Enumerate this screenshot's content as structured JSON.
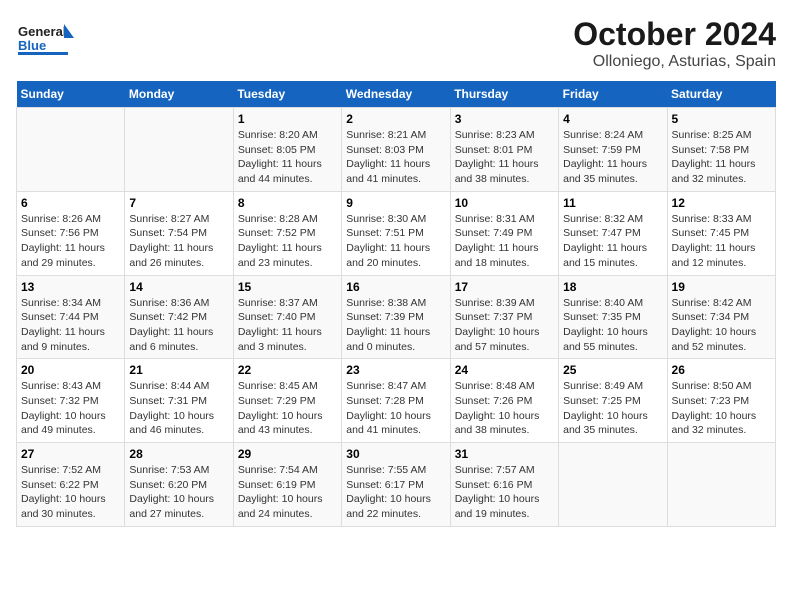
{
  "header": {
    "logo_line1": "General",
    "logo_line2": "Blue",
    "title": "October 2024",
    "subtitle": "Olloniego, Asturias, Spain"
  },
  "days_of_week": [
    "Sunday",
    "Monday",
    "Tuesday",
    "Wednesday",
    "Thursday",
    "Friday",
    "Saturday"
  ],
  "weeks": [
    [
      {
        "day": "",
        "info": ""
      },
      {
        "day": "",
        "info": ""
      },
      {
        "day": "1",
        "info": "Sunrise: 8:20 AM\nSunset: 8:05 PM\nDaylight: 11 hours and 44 minutes."
      },
      {
        "day": "2",
        "info": "Sunrise: 8:21 AM\nSunset: 8:03 PM\nDaylight: 11 hours and 41 minutes."
      },
      {
        "day": "3",
        "info": "Sunrise: 8:23 AM\nSunset: 8:01 PM\nDaylight: 11 hours and 38 minutes."
      },
      {
        "day": "4",
        "info": "Sunrise: 8:24 AM\nSunset: 7:59 PM\nDaylight: 11 hours and 35 minutes."
      },
      {
        "day": "5",
        "info": "Sunrise: 8:25 AM\nSunset: 7:58 PM\nDaylight: 11 hours and 32 minutes."
      }
    ],
    [
      {
        "day": "6",
        "info": "Sunrise: 8:26 AM\nSunset: 7:56 PM\nDaylight: 11 hours and 29 minutes."
      },
      {
        "day": "7",
        "info": "Sunrise: 8:27 AM\nSunset: 7:54 PM\nDaylight: 11 hours and 26 minutes."
      },
      {
        "day": "8",
        "info": "Sunrise: 8:28 AM\nSunset: 7:52 PM\nDaylight: 11 hours and 23 minutes."
      },
      {
        "day": "9",
        "info": "Sunrise: 8:30 AM\nSunset: 7:51 PM\nDaylight: 11 hours and 20 minutes."
      },
      {
        "day": "10",
        "info": "Sunrise: 8:31 AM\nSunset: 7:49 PM\nDaylight: 11 hours and 18 minutes."
      },
      {
        "day": "11",
        "info": "Sunrise: 8:32 AM\nSunset: 7:47 PM\nDaylight: 11 hours and 15 minutes."
      },
      {
        "day": "12",
        "info": "Sunrise: 8:33 AM\nSunset: 7:45 PM\nDaylight: 11 hours and 12 minutes."
      }
    ],
    [
      {
        "day": "13",
        "info": "Sunrise: 8:34 AM\nSunset: 7:44 PM\nDaylight: 11 hours and 9 minutes."
      },
      {
        "day": "14",
        "info": "Sunrise: 8:36 AM\nSunset: 7:42 PM\nDaylight: 11 hours and 6 minutes."
      },
      {
        "day": "15",
        "info": "Sunrise: 8:37 AM\nSunset: 7:40 PM\nDaylight: 11 hours and 3 minutes."
      },
      {
        "day": "16",
        "info": "Sunrise: 8:38 AM\nSunset: 7:39 PM\nDaylight: 11 hours and 0 minutes."
      },
      {
        "day": "17",
        "info": "Sunrise: 8:39 AM\nSunset: 7:37 PM\nDaylight: 10 hours and 57 minutes."
      },
      {
        "day": "18",
        "info": "Sunrise: 8:40 AM\nSunset: 7:35 PM\nDaylight: 10 hours and 55 minutes."
      },
      {
        "day": "19",
        "info": "Sunrise: 8:42 AM\nSunset: 7:34 PM\nDaylight: 10 hours and 52 minutes."
      }
    ],
    [
      {
        "day": "20",
        "info": "Sunrise: 8:43 AM\nSunset: 7:32 PM\nDaylight: 10 hours and 49 minutes."
      },
      {
        "day": "21",
        "info": "Sunrise: 8:44 AM\nSunset: 7:31 PM\nDaylight: 10 hours and 46 minutes."
      },
      {
        "day": "22",
        "info": "Sunrise: 8:45 AM\nSunset: 7:29 PM\nDaylight: 10 hours and 43 minutes."
      },
      {
        "day": "23",
        "info": "Sunrise: 8:47 AM\nSunset: 7:28 PM\nDaylight: 10 hours and 41 minutes."
      },
      {
        "day": "24",
        "info": "Sunrise: 8:48 AM\nSunset: 7:26 PM\nDaylight: 10 hours and 38 minutes."
      },
      {
        "day": "25",
        "info": "Sunrise: 8:49 AM\nSunset: 7:25 PM\nDaylight: 10 hours and 35 minutes."
      },
      {
        "day": "26",
        "info": "Sunrise: 8:50 AM\nSunset: 7:23 PM\nDaylight: 10 hours and 32 minutes."
      }
    ],
    [
      {
        "day": "27",
        "info": "Sunrise: 7:52 AM\nSunset: 6:22 PM\nDaylight: 10 hours and 30 minutes."
      },
      {
        "day": "28",
        "info": "Sunrise: 7:53 AM\nSunset: 6:20 PM\nDaylight: 10 hours and 27 minutes."
      },
      {
        "day": "29",
        "info": "Sunrise: 7:54 AM\nSunset: 6:19 PM\nDaylight: 10 hours and 24 minutes."
      },
      {
        "day": "30",
        "info": "Sunrise: 7:55 AM\nSunset: 6:17 PM\nDaylight: 10 hours and 22 minutes."
      },
      {
        "day": "31",
        "info": "Sunrise: 7:57 AM\nSunset: 6:16 PM\nDaylight: 10 hours and 19 minutes."
      },
      {
        "day": "",
        "info": ""
      },
      {
        "day": "",
        "info": ""
      }
    ]
  ]
}
